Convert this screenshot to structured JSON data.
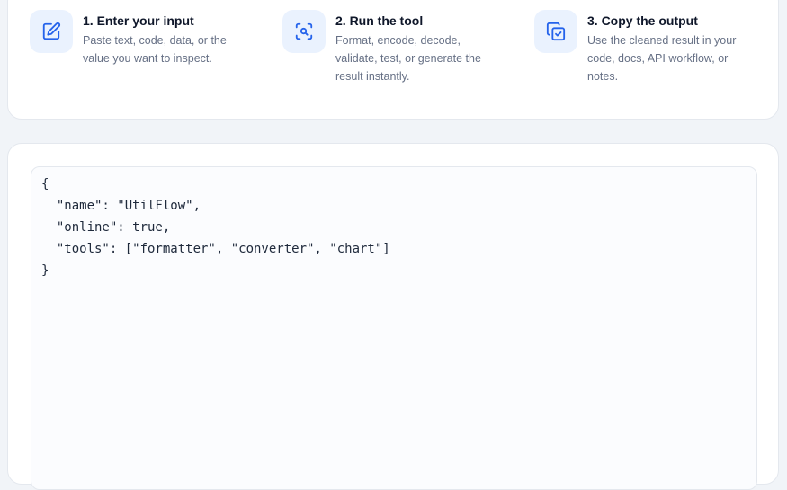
{
  "steps": [
    {
      "icon": "edit-icon",
      "title": "1. Enter your input",
      "desc_lines": [
        "Paste text, code, data, or the",
        "value you want to inspect."
      ]
    },
    {
      "icon": "scan-search-icon",
      "title": "2. Run the tool",
      "desc_lines": [
        "Format, encode, decode,",
        "validate, test, or generate the",
        "result instantly."
      ]
    },
    {
      "icon": "copy-check-icon",
      "title": "3. Copy the output",
      "desc_lines": [
        "Use the cleaned result in your",
        "code, docs, API workflow, or",
        "notes."
      ]
    }
  ],
  "editor": {
    "content": "{\n  \"name\": \"UtilFlow\",\n  \"online\": true,\n  \"tools\": [\"formatter\", \"converter\", \"chart\"]\n}"
  },
  "colors": {
    "accent": "#2563eb",
    "icon_bg": "#eaf2fe"
  }
}
